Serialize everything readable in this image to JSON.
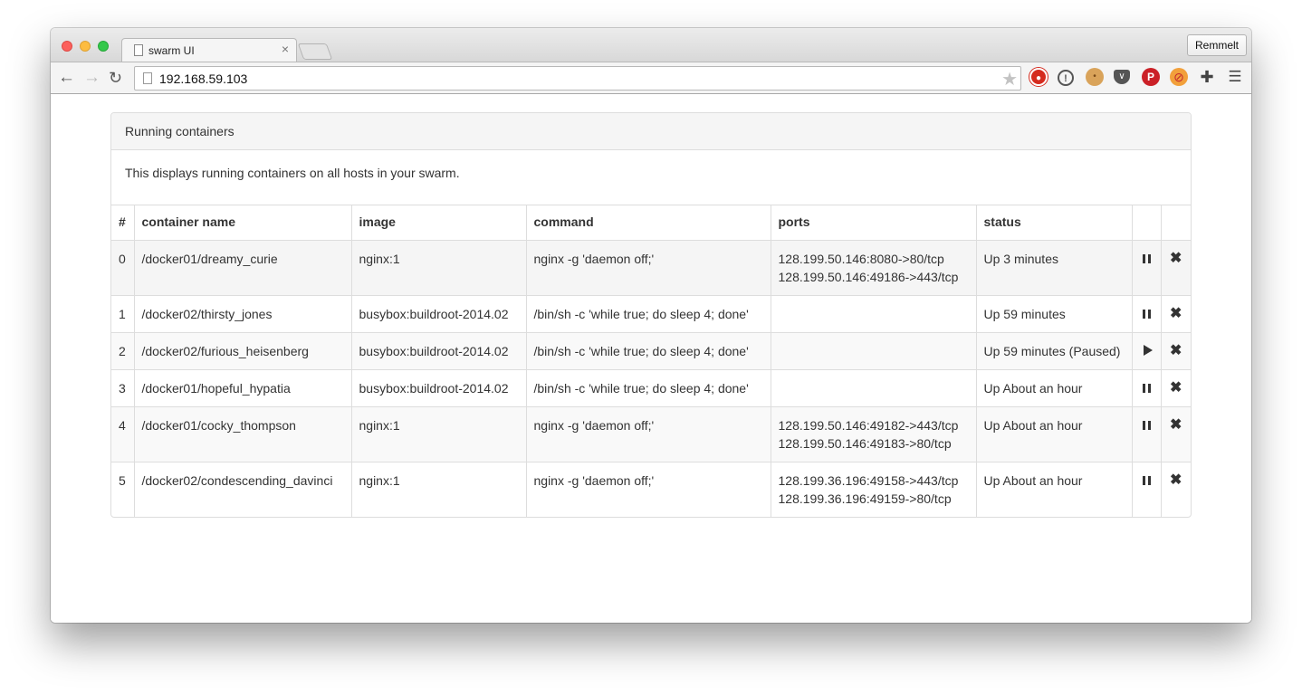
{
  "browser": {
    "tab_title": "swarm UI",
    "tab_close": "×",
    "profile_label": "Remmelt",
    "url": "192.168.59.103"
  },
  "panel": {
    "heading": "Running containers",
    "description": "This displays running containers on all hosts in your swarm."
  },
  "table": {
    "headers": [
      "#",
      "container name",
      "image",
      "command",
      "ports",
      "status",
      "",
      ""
    ],
    "rows": [
      {
        "index": "0",
        "name": "/docker01/dreamy_curie",
        "image": "nginx:1",
        "command": "nginx -g 'daemon off;'",
        "ports": [
          "128.199.50.146:8080->80/tcp",
          "128.199.50.146:49186->443/tcp"
        ],
        "status": "Up 3 minutes",
        "action": "pause"
      },
      {
        "index": "1",
        "name": "/docker02/thirsty_jones",
        "image": "busybox:buildroot-2014.02",
        "command": "/bin/sh -c 'while true; do sleep 4; done'",
        "ports": [
          "",
          ""
        ],
        "status": "Up 59 minutes",
        "action": "pause"
      },
      {
        "index": "2",
        "name": "/docker02/furious_heisenberg",
        "image": "busybox:buildroot-2014.02",
        "command": "/bin/sh -c 'while true; do sleep 4; done'",
        "ports": [
          "",
          ""
        ],
        "status": "Up 59 minutes (Paused)",
        "action": "play"
      },
      {
        "index": "3",
        "name": "/docker01/hopeful_hypatia",
        "image": "busybox:buildroot-2014.02",
        "command": "/bin/sh -c 'while true; do sleep 4; done'",
        "ports": [
          "",
          ""
        ],
        "status": "Up About an hour",
        "action": "pause"
      },
      {
        "index": "4",
        "name": "/docker01/cocky_thompson",
        "image": "nginx:1",
        "command": "nginx -g 'daemon off;'",
        "ports": [
          "128.199.50.146:49182->443/tcp",
          "128.199.50.146:49183->80/tcp"
        ],
        "status": "Up About an hour",
        "action": "pause"
      },
      {
        "index": "5",
        "name": "/docker02/condescending_davinci",
        "image": "nginx:1",
        "command": "nginx -g 'daemon off;'",
        "ports": [
          "128.199.36.196:49158->443/tcp",
          "128.199.36.196:49159->80/tcp"
        ],
        "status": "Up About an hour",
        "action": "pause"
      }
    ],
    "remove_glyph": "✖"
  }
}
